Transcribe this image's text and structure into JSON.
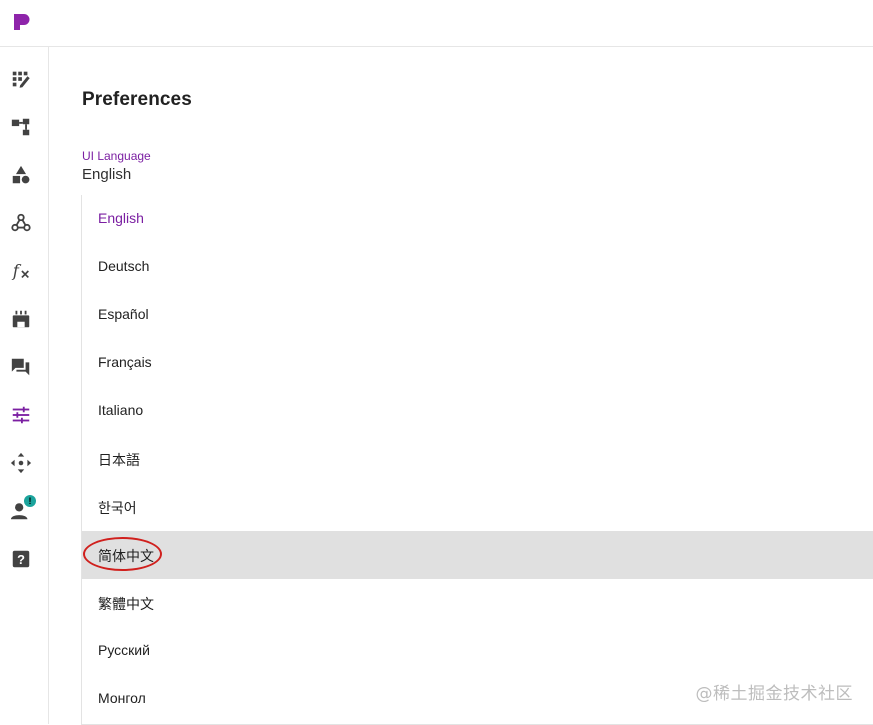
{
  "app": {
    "logo_icon": "app-logo-icon",
    "logo_colors": {
      "primary": "#8e24aa",
      "secondary": "#26c6da"
    }
  },
  "sidebar": {
    "items": [
      {
        "icon": "dashboard-edit-icon"
      },
      {
        "icon": "hierarchy-icon"
      },
      {
        "icon": "shapes-icon"
      },
      {
        "icon": "webhook-icon"
      },
      {
        "icon": "function-icon"
      },
      {
        "icon": "plugin-icon"
      },
      {
        "icon": "forum-icon"
      },
      {
        "icon": "settings-sliders-icon",
        "active": true
      },
      {
        "icon": "move-icon"
      },
      {
        "icon": "user-icon",
        "badge": "!"
      },
      {
        "icon": "help-icon"
      }
    ]
  },
  "main": {
    "title": "Preferences",
    "language_select": {
      "label": "UI Language",
      "value": "English",
      "options": [
        {
          "label": "English",
          "selected": true
        },
        {
          "label": "Deutsch"
        },
        {
          "label": "Español"
        },
        {
          "label": "Français"
        },
        {
          "label": "Italiano"
        },
        {
          "label": "日本語"
        },
        {
          "label": "한국어"
        },
        {
          "label": "简体中文",
          "highlighted": true,
          "circled": true
        },
        {
          "label": "繁體中文"
        },
        {
          "label": "Русский"
        },
        {
          "label": "Монгол"
        }
      ]
    }
  },
  "watermark": "@稀土掘金技术社区",
  "colors": {
    "accent": "#7b1fa2",
    "highlight": "#e0e0e0",
    "annotation": "#d0201d",
    "icon": "#424242",
    "badge": "#1ba39c"
  }
}
